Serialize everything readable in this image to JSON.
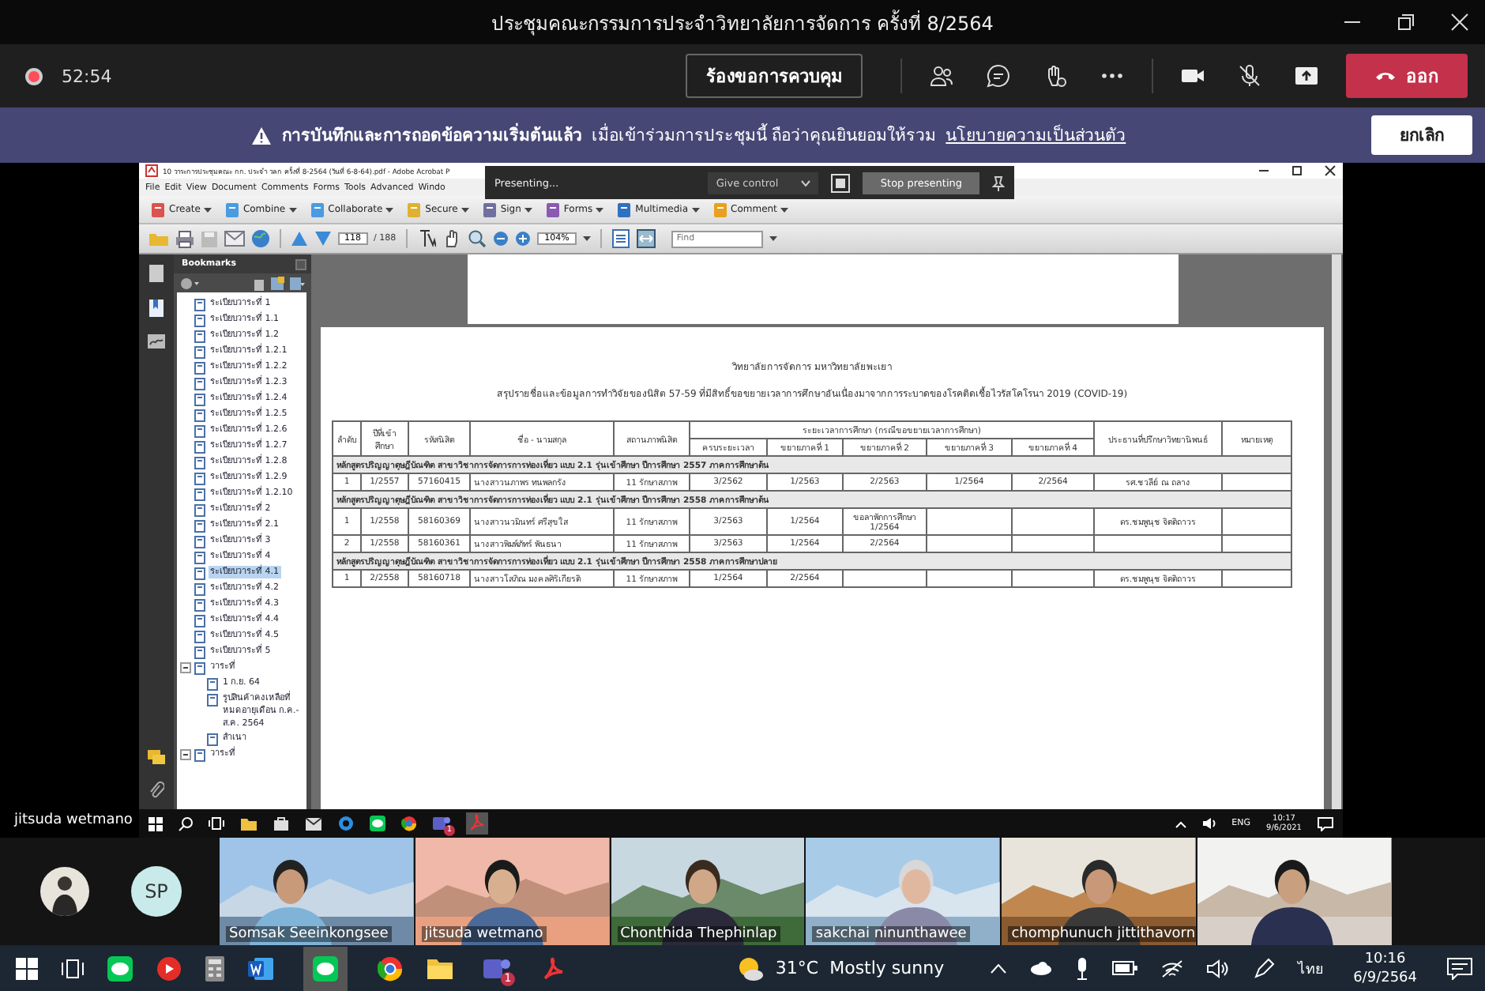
{
  "window": {
    "title": "ประชุมคณะกรรมการประจำวิทยาลัยการจัดการ ครั้งที่ 8/2564"
  },
  "meeting_bar": {
    "recording": true,
    "timer": "52:54",
    "request_control_button": "ร้องขอการควบคุม",
    "leave_button": "ออก"
  },
  "banner": {
    "title": "การบันทึกและการถอดข้อความเริ่มต้นแล้ว",
    "message": "เมื่อเข้าร่วมการประชุมนี้ ถือว่าคุณยินยอมให้รวม",
    "link": "นโยบายความเป็นส่วนตัว",
    "dismiss_button": "ยกเลิก"
  },
  "shared_screen": {
    "presenter": "jitsuda wetmano",
    "presenting_bar": {
      "status": "Presenting...",
      "give_control": "Give control",
      "stop_button": "Stop presenting"
    },
    "acrobat": {
      "title": "10 วาระการประชุมคณะ กก. ประจำ วลก ครั้งที่ 8-2564 (วันที่ 6-8-64).pdf - Adobe Acrobat P",
      "menu": [
        "File",
        "Edit",
        "View",
        "Document",
        "Comments",
        "Forms",
        "Tools",
        "Advanced",
        "Windo"
      ],
      "toolbar": [
        "Create",
        "Combine",
        "Collaborate",
        "Secure",
        "Sign",
        "Forms",
        "Multimedia",
        "Comment"
      ],
      "page": "118",
      "page_count": "/ 188",
      "zoom": "104%",
      "find_placeholder": "Find",
      "bookmarks_title": "Bookmarks",
      "bookmarks": [
        {
          "label": "ระเบียบวาระที่ 1",
          "selected": false
        },
        {
          "label": "ระเบียบวาระที่ 1.1",
          "selected": false
        },
        {
          "label": "ระเบียบวาระที่ 1.2",
          "selected": false
        },
        {
          "label": "ระเบียบวาระที่ 1.2.1",
          "selected": false
        },
        {
          "label": "ระเบียบวาระที่ 1.2.2",
          "selected": false
        },
        {
          "label": "ระเบียบวาระที่ 1.2.3",
          "selected": false
        },
        {
          "label": "ระเบียบวาระที่ 1.2.4",
          "selected": false
        },
        {
          "label": "ระเบียบวาระที่ 1.2.5",
          "selected": false
        },
        {
          "label": "ระเบียบวาระที่ 1.2.6",
          "selected": false
        },
        {
          "label": "ระเบียบวาระที่ 1.2.7",
          "selected": false
        },
        {
          "label": "ระเบียบวาระที่ 1.2.8",
          "selected": false
        },
        {
          "label": "ระเบียบวาระที่ 1.2.9",
          "selected": false
        },
        {
          "label": "ระเบียบวาระที่ 1.2.10",
          "selected": false
        },
        {
          "label": "ระเบียบวาระที่ 2",
          "selected": false
        },
        {
          "label": "ระเบียบวาระที่ 2.1",
          "selected": false
        },
        {
          "label": "ระเบียบวาระที่ 3",
          "selected": false
        },
        {
          "label": "ระเบียบวาระที่ 4",
          "selected": false
        },
        {
          "label": "ระเบียบวาระที่ 4.1",
          "selected": true
        },
        {
          "label": "ระเบียบวาระที่ 4.2",
          "selected": false
        },
        {
          "label": "ระเบียบวาระที่ 4.3",
          "selected": false
        },
        {
          "label": "ระเบียบวาระที่ 4.4",
          "selected": false
        },
        {
          "label": "ระเบียบวาระที่ 4.5",
          "selected": false
        },
        {
          "label": "ระเบียบวาระที่ 5",
          "selected": false
        },
        {
          "label": "วาระที่",
          "selected": false,
          "expanded": true,
          "children": [
            {
              "label": "1 ก.ย. 64",
              "selected": false
            },
            {
              "label": "รูปสินค้าคงเหลือที่หมดอายุเดือน ก.ค.-ส.ค. 2564",
              "selected": false
            },
            {
              "label": "สำเนา",
              "selected": false
            }
          ]
        },
        {
          "label": "วาระที่",
          "selected": false,
          "expanded": true
        }
      ],
      "document": {
        "heading": "วิทยาลัยการจัดการ มหาวิทยาลัยพะเยา",
        "subheading": "สรุปรายชื่อและข้อมูลการทำวิจัยของนิสิต 57-59 ที่มีสิทธิ์ขอขยายเวลาการศึกษาอันเนื่องมาจากการระบาดของโรคติดเชื้อไวรัสโคโรนา 2019 (COVID-19)",
        "columns": [
          {
            "label": "ลำดับ"
          },
          {
            "label": "ปีที่เข้าศึกษา"
          },
          {
            "label": "รหัสนิสิต"
          },
          {
            "label": "ชื่อ - นามสกุล"
          },
          {
            "label": "สถานภาพนิสิต"
          },
          {
            "label": "ระยะเวลาการศึกษา (กรณีขอขยายเวลาการศึกษา)",
            "children": [
              {
                "label": "ครบระยะเวลา"
              },
              {
                "label": "ขยายภาคที่ 1"
              },
              {
                "label": "ขยายภาคที่ 2"
              },
              {
                "label": "ขยายภาคที่ 3"
              },
              {
                "label": "ขยายภาคที่ 4"
              }
            ]
          },
          {
            "label": "ประธานที่ปรึกษาวิทยานิพนธ์"
          },
          {
            "label": "หมายเหตุ"
          }
        ],
        "sections": [
          {
            "title": "หลักสูตรปริญญาดุษฎีบัณฑิต สาขาวิชาการจัดการการท่องเที่ยว แบบ 2.1 รุ่นเข้าศึกษา ปีการศึกษา 2557 ภาคการศึกษาต้น",
            "rows": [
              [
                "1",
                "1/2557",
                "57160415",
                "นางสาวนภาพร ทนพลกรัง",
                "11 รักษาสภาพ",
                "3/2562",
                "1/2563",
                "2/2563",
                "1/2564",
                "2/2564",
                "รศ.ชวลีย์ ณ ถลาง",
                null
              ]
            ]
          },
          {
            "title": "หลักสูตรปริญญาดุษฎีบัณฑิต สาขาวิชาการจัดการการท่องเที่ยว แบบ 2.1 รุ่นเข้าศึกษา ปีการศึกษา 2558 ภาคการศึกษาต้น",
            "rows": [
              [
                "1",
                "1/2558",
                "58160369",
                "นางสาวนวมินทร์ ศรีสุขใส",
                "11 รักษาสภาพ",
                "3/2563",
                "1/2564",
                "ขอลาพักการศึกษา 1/2564",
                null,
                null,
                "ดร.ชมพูนุช จิตติถาวร",
                null
              ],
              [
                "2",
                "1/2558",
                "58160361",
                "นางสาวพิมพ์ภัทร์ พันธนา",
                "11 รักษาสภาพ",
                "3/2563",
                "1/2564",
                "2/2564",
                null,
                null,
                null,
                null
              ]
            ]
          },
          {
            "title": "หลักสูตรปริญญาดุษฎีบัณฑิต สาขาวิชาการจัดการการท่องเที่ยว แบบ 2.1 รุ่นเข้าศึกษา ปีการศึกษา 2558 ภาคการศึกษาปลาย",
            "rows": [
              [
                "1",
                "2/2558",
                "58160718",
                "นางสาวโสภิณ มงคลศิริเกียรติ",
                "11 รักษาสภาพ",
                "1/2564",
                "2/2564",
                null,
                null,
                null,
                "ดร.ชมพูนุช จิตติถาวร",
                null
              ]
            ]
          }
        ]
      }
    },
    "taskbar": {
      "teams_badge": "1",
      "language": "ENG",
      "time": "10:17",
      "date": "9/6/2021"
    }
  },
  "participants": [
    {
      "kind": "photo_avatar"
    },
    {
      "kind": "initials",
      "initials": "SP"
    },
    {
      "kind": "video",
      "name": "Somsak Seeinkongsee"
    },
    {
      "kind": "video",
      "name": "jitsuda wetmano"
    },
    {
      "kind": "video",
      "name": "Chonthida Thephinlap"
    },
    {
      "kind": "video",
      "name": "sakchai ninunthawee"
    },
    {
      "kind": "video",
      "name": "chomphunuch jittithavorn"
    },
    {
      "kind": "video"
    }
  ],
  "taskbar": {
    "teams_badge": "1",
    "temperature": "31°C",
    "weather": "Mostly sunny",
    "language": "ไทย",
    "time": "10:16",
    "date": "6/9/2564"
  }
}
